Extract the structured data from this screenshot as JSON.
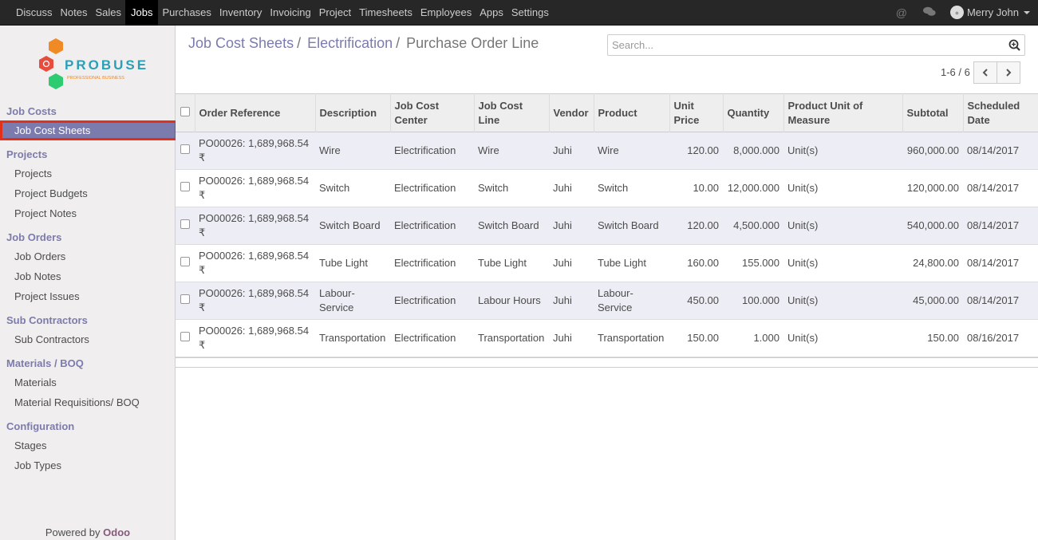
{
  "topmenu": [
    "Discuss",
    "Notes",
    "Sales",
    "Jobs",
    "Purchases",
    "Inventory",
    "Invoicing",
    "Project",
    "Timesheets",
    "Employees",
    "Apps",
    "Settings"
  ],
  "topmenu_active": "Jobs",
  "user": {
    "name": "Merry John"
  },
  "logo": {
    "name": "PROBUSE",
    "tagline": "PROFESSIONAL BUSINESS"
  },
  "sidebar": {
    "sections": [
      {
        "title": "Job Costs",
        "items": [
          "Job Cost Sheets"
        ]
      },
      {
        "title": "Projects",
        "items": [
          "Projects",
          "Project Budgets",
          "Project Notes"
        ]
      },
      {
        "title": "Job Orders",
        "items": [
          "Job Orders",
          "Job Notes",
          "Project Issues"
        ]
      },
      {
        "title": "Sub Contractors",
        "items": [
          "Sub Contractors"
        ]
      },
      {
        "title": "Materials / BOQ",
        "items": [
          "Materials",
          "Material Requisitions/ BOQ"
        ]
      },
      {
        "title": "Configuration",
        "items": [
          "Stages",
          "Job Types"
        ]
      }
    ],
    "active_item": "Job Cost Sheets",
    "powered_prefix": "Powered by",
    "powered_brand": "Odoo"
  },
  "breadcrumb": {
    "items": [
      "Job Cost Sheets",
      "Electrification",
      "Purchase Order Line"
    ],
    "separator": "/"
  },
  "search": {
    "placeholder": "Search..."
  },
  "pager": {
    "text": "1-6 / 6",
    "prev": "‹",
    "next": "›"
  },
  "table": {
    "headers": [
      "Order Reference",
      "Description",
      "Job Cost Center",
      "Job Cost Line",
      "Vendor",
      "Product",
      "Unit Price",
      "Quantity",
      "Product Unit of Measure",
      "Subtotal",
      "Scheduled Date"
    ],
    "rows": [
      [
        "PO00026: 1,689,968.54 ₹",
        "Wire",
        "Electrification",
        "Wire",
        "Juhi",
        "Wire",
        "120.00",
        "8,000.000",
        "Unit(s)",
        "960,000.00",
        "08/14/2017"
      ],
      [
        "PO00026: 1,689,968.54 ₹",
        "Switch",
        "Electrification",
        "Switch",
        "Juhi",
        "Switch",
        "10.00",
        "12,000.000",
        "Unit(s)",
        "120,000.00",
        "08/14/2017"
      ],
      [
        "PO00026: 1,689,968.54 ₹",
        "Switch Board",
        "Electrification",
        "Switch Board",
        "Juhi",
        "Switch Board",
        "120.00",
        "4,500.000",
        "Unit(s)",
        "540,000.00",
        "08/14/2017"
      ],
      [
        "PO00026: 1,689,968.54 ₹",
        "Tube Light",
        "Electrification",
        "Tube Light",
        "Juhi",
        "Tube Light",
        "160.00",
        "155.000",
        "Unit(s)",
        "24,800.00",
        "08/14/2017"
      ],
      [
        "PO00026: 1,689,968.54 ₹",
        "Labour-Service",
        "Electrification",
        "Labour Hours",
        "Juhi",
        "Labour-Service",
        "450.00",
        "100.000",
        "Unit(s)",
        "45,000.00",
        "08/14/2017"
      ],
      [
        "PO00026: 1,689,968.54 ₹",
        "Transportation",
        "Electrification",
        "Transportation",
        "Juhi",
        "Transportation",
        "150.00",
        "1.000",
        "Unit(s)",
        "150.00",
        "08/16/2017"
      ]
    ]
  },
  "colors": {
    "accent": "#7c7bad",
    "highlight_border": "#e3301b",
    "navbar": "#272727"
  }
}
